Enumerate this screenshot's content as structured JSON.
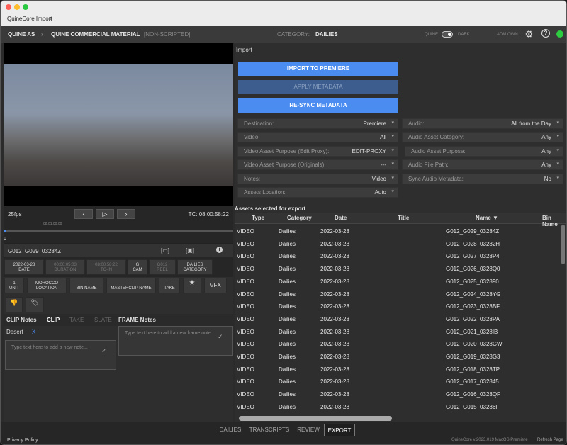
{
  "app": {
    "title": "QuineCore Import"
  },
  "header": {
    "org": "QUINE AS",
    "project": "QUINE COMMERCIAL MATERIAL",
    "scripted": "[NON-SCRIPTED]",
    "category_label": "CATEGORY:",
    "category_value": "DAILIES",
    "theme_left": "QUINE",
    "theme_right": "DARK",
    "user": "ADM OWN"
  },
  "player": {
    "fps": "25fps",
    "tc": "TC: 08:00:58:22",
    "timecode_small": "08:01:00:00"
  },
  "clip": {
    "name": "G012_G029_03284Z"
  },
  "meta1": [
    {
      "v": "2022-03-28",
      "k": "DATE"
    },
    {
      "v": "00:00:05:03",
      "k": "DURATION"
    },
    {
      "v": "08:00:58:22",
      "k": "TC-IN"
    },
    {
      "v": "G",
      "k": "CAM"
    },
    {
      "v": "G012",
      "k": "REEL"
    },
    {
      "v": "DAILIES",
      "k": "CATEGORY"
    }
  ],
  "meta2": [
    {
      "v": "1",
      "k": "UNIT"
    },
    {
      "v": "MOROCCO",
      "k": "LOCATION"
    },
    {
      "v": "--",
      "k": "BIN NAME"
    },
    {
      "v": "--",
      "k": "MASTERCLIP NAME"
    },
    {
      "v": "--",
      "k": "TAKE"
    }
  ],
  "vfx": "VFX",
  "notes": {
    "tab_clip_notes": "CLIP Notes",
    "tab_clip": "CLIP",
    "tab_take": "TAKE",
    "tab_slate": "SLATE",
    "frame_notes": "FRAME Notes",
    "tag": "Desert",
    "tag_x": "X",
    "clip_placeholder": "Type text here to add a new note...",
    "frame_placeholder": "Type text here to add a new frame note..."
  },
  "import": {
    "title": "Import",
    "btn_import": "IMPORT TO PREMIERE",
    "btn_apply": "APPLY METADATA",
    "btn_resync": "RE-SYNC METADATA"
  },
  "fields_left": [
    {
      "l": "Destination:",
      "v": "Premiere"
    },
    {
      "l": "Video:",
      "v": "All"
    },
    {
      "l": "Video Asset Purpose (Edit Proxy):",
      "v": "EDIT-PROXY"
    },
    {
      "l": "Video Asset Purpose (Originals):",
      "v": "---"
    },
    {
      "l": "Notes:",
      "v": "Video"
    },
    {
      "l": "Assets Location:",
      "v": "Auto"
    }
  ],
  "fields_right": [
    {
      "l": "Audio:",
      "v": "All from the Day"
    },
    {
      "l": "Audio Asset Category:",
      "v": "Any"
    },
    {
      "l": "Audio Asset Purpose:",
      "v": "Any"
    },
    {
      "l": "Audio File Path:",
      "v": "Any"
    },
    {
      "l": "Sync Audio Metadata:",
      "v": "No"
    }
  ],
  "assets": {
    "title": "Assets selected for export",
    "cols": [
      "Type",
      "Category",
      "Date",
      "Title",
      "Name ▼",
      "Bin Name"
    ],
    "rows": [
      [
        "VIDEO",
        "Dailies",
        "2022-03-28",
        "G012_G029_03284Z"
      ],
      [
        "VIDEO",
        "Dailies",
        "2022-03-28",
        "G012_G028_03282H"
      ],
      [
        "VIDEO",
        "Dailies",
        "2022-03-28",
        "G012_G027_0328P4"
      ],
      [
        "VIDEO",
        "Dailies",
        "2022-03-28",
        "G012_G026_0328Q0"
      ],
      [
        "VIDEO",
        "Dailies",
        "2022-03-28",
        "G012_G025_032890"
      ],
      [
        "VIDEO",
        "Dailies",
        "2022-03-28",
        "G012_G024_0328YG"
      ],
      [
        "VIDEO",
        "Dailies",
        "2022-03-28",
        "G012_G023_0328BF"
      ],
      [
        "VIDEO",
        "Dailies",
        "2022-03-28",
        "G012_G022_0328PA"
      ],
      [
        "VIDEO",
        "Dailies",
        "2022-03-28",
        "G012_G021_0328IB"
      ],
      [
        "VIDEO",
        "Dailies",
        "2022-03-28",
        "G012_G020_0328GW"
      ],
      [
        "VIDEO",
        "Dailies",
        "2022-03-28",
        "G012_G019_0328G3"
      ],
      [
        "VIDEO",
        "Dailies",
        "2022-03-28",
        "G012_G018_0328TP"
      ],
      [
        "VIDEO",
        "Dailies",
        "2022-03-28",
        "G012_G017_032845"
      ],
      [
        "VIDEO",
        "Dailies",
        "2022-03-28",
        "G012_G016_0328QF"
      ],
      [
        "VIDEO",
        "Dailies",
        "2022-03-28",
        "G012_G015_03286F"
      ]
    ]
  },
  "bottom": {
    "tabs": [
      "DAILIES",
      "TRANSCRIPTS",
      "REVIEW",
      "EXPORT"
    ],
    "privacy": "Privacy Policy",
    "version": "QuineCore v.2023.019 MacOS Premiere",
    "refresh": "Refresh Page"
  }
}
